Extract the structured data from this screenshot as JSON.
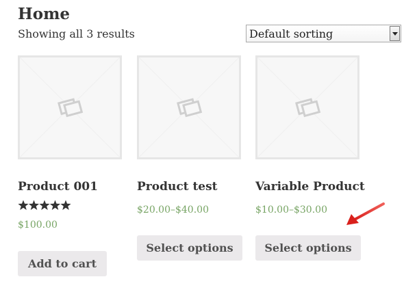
{
  "page": {
    "title": "Home",
    "result_count": "Showing all 3 results"
  },
  "sorting": {
    "selected": "Default sorting",
    "icon": "chevron-down-icon"
  },
  "colors": {
    "price": "#77a464",
    "button_bg": "#ebe9eb",
    "annotation_arrow": "#e8302c"
  },
  "products": [
    {
      "name": "Product 001",
      "rating": 5,
      "rating_max": 5,
      "price": "$100.00",
      "button_label": "Add to cart",
      "image_icon": "placeholder-image-icon"
    },
    {
      "name": "Product test",
      "price": "$20.00–$40.00",
      "button_label": "Select options",
      "image_icon": "placeholder-image-icon"
    },
    {
      "name": "Variable Product",
      "price": "$10.00–$30.00",
      "button_label": "Select options",
      "image_icon": "placeholder-image-icon"
    }
  ]
}
